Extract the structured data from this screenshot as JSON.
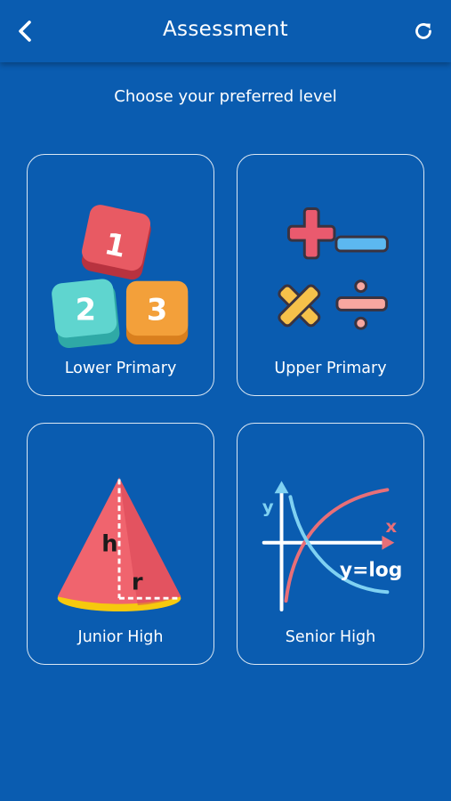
{
  "header": {
    "title": "Assessment",
    "back_icon": "chevron-left-icon",
    "refresh_icon": "refresh-icon"
  },
  "subtitle": "Choose your preferred level",
  "levels": [
    {
      "label": "Lower Primary",
      "icon": "number-blocks-icon",
      "digits": [
        "1",
        "2",
        "3"
      ]
    },
    {
      "label": "Upper Primary",
      "icon": "arithmetic-operators-icon"
    },
    {
      "label": "Junior High",
      "icon": "cone-icon",
      "marks": [
        "h",
        "r"
      ]
    },
    {
      "label": "Senior High",
      "icon": "log-graph-icon",
      "marks": [
        "y",
        "x",
        "y=log"
      ]
    }
  ],
  "colors": {
    "background": "#0a5cb0",
    "text": "#ffffff",
    "block_red": "#e85a63",
    "block_teal": "#5fd5cf",
    "block_orange": "#f3a03a",
    "op_plus": "#ea5a6e",
    "op_minus": "#5cb8f0",
    "op_times": "#f6c14a",
    "op_divide": "#f7a7a0",
    "cone": "#f0646e",
    "cone_base": "#f6c90e",
    "graph_axis": "#ffffff",
    "graph_curve_up": "#e86f78",
    "graph_curve_down": "#7fd1f2"
  }
}
